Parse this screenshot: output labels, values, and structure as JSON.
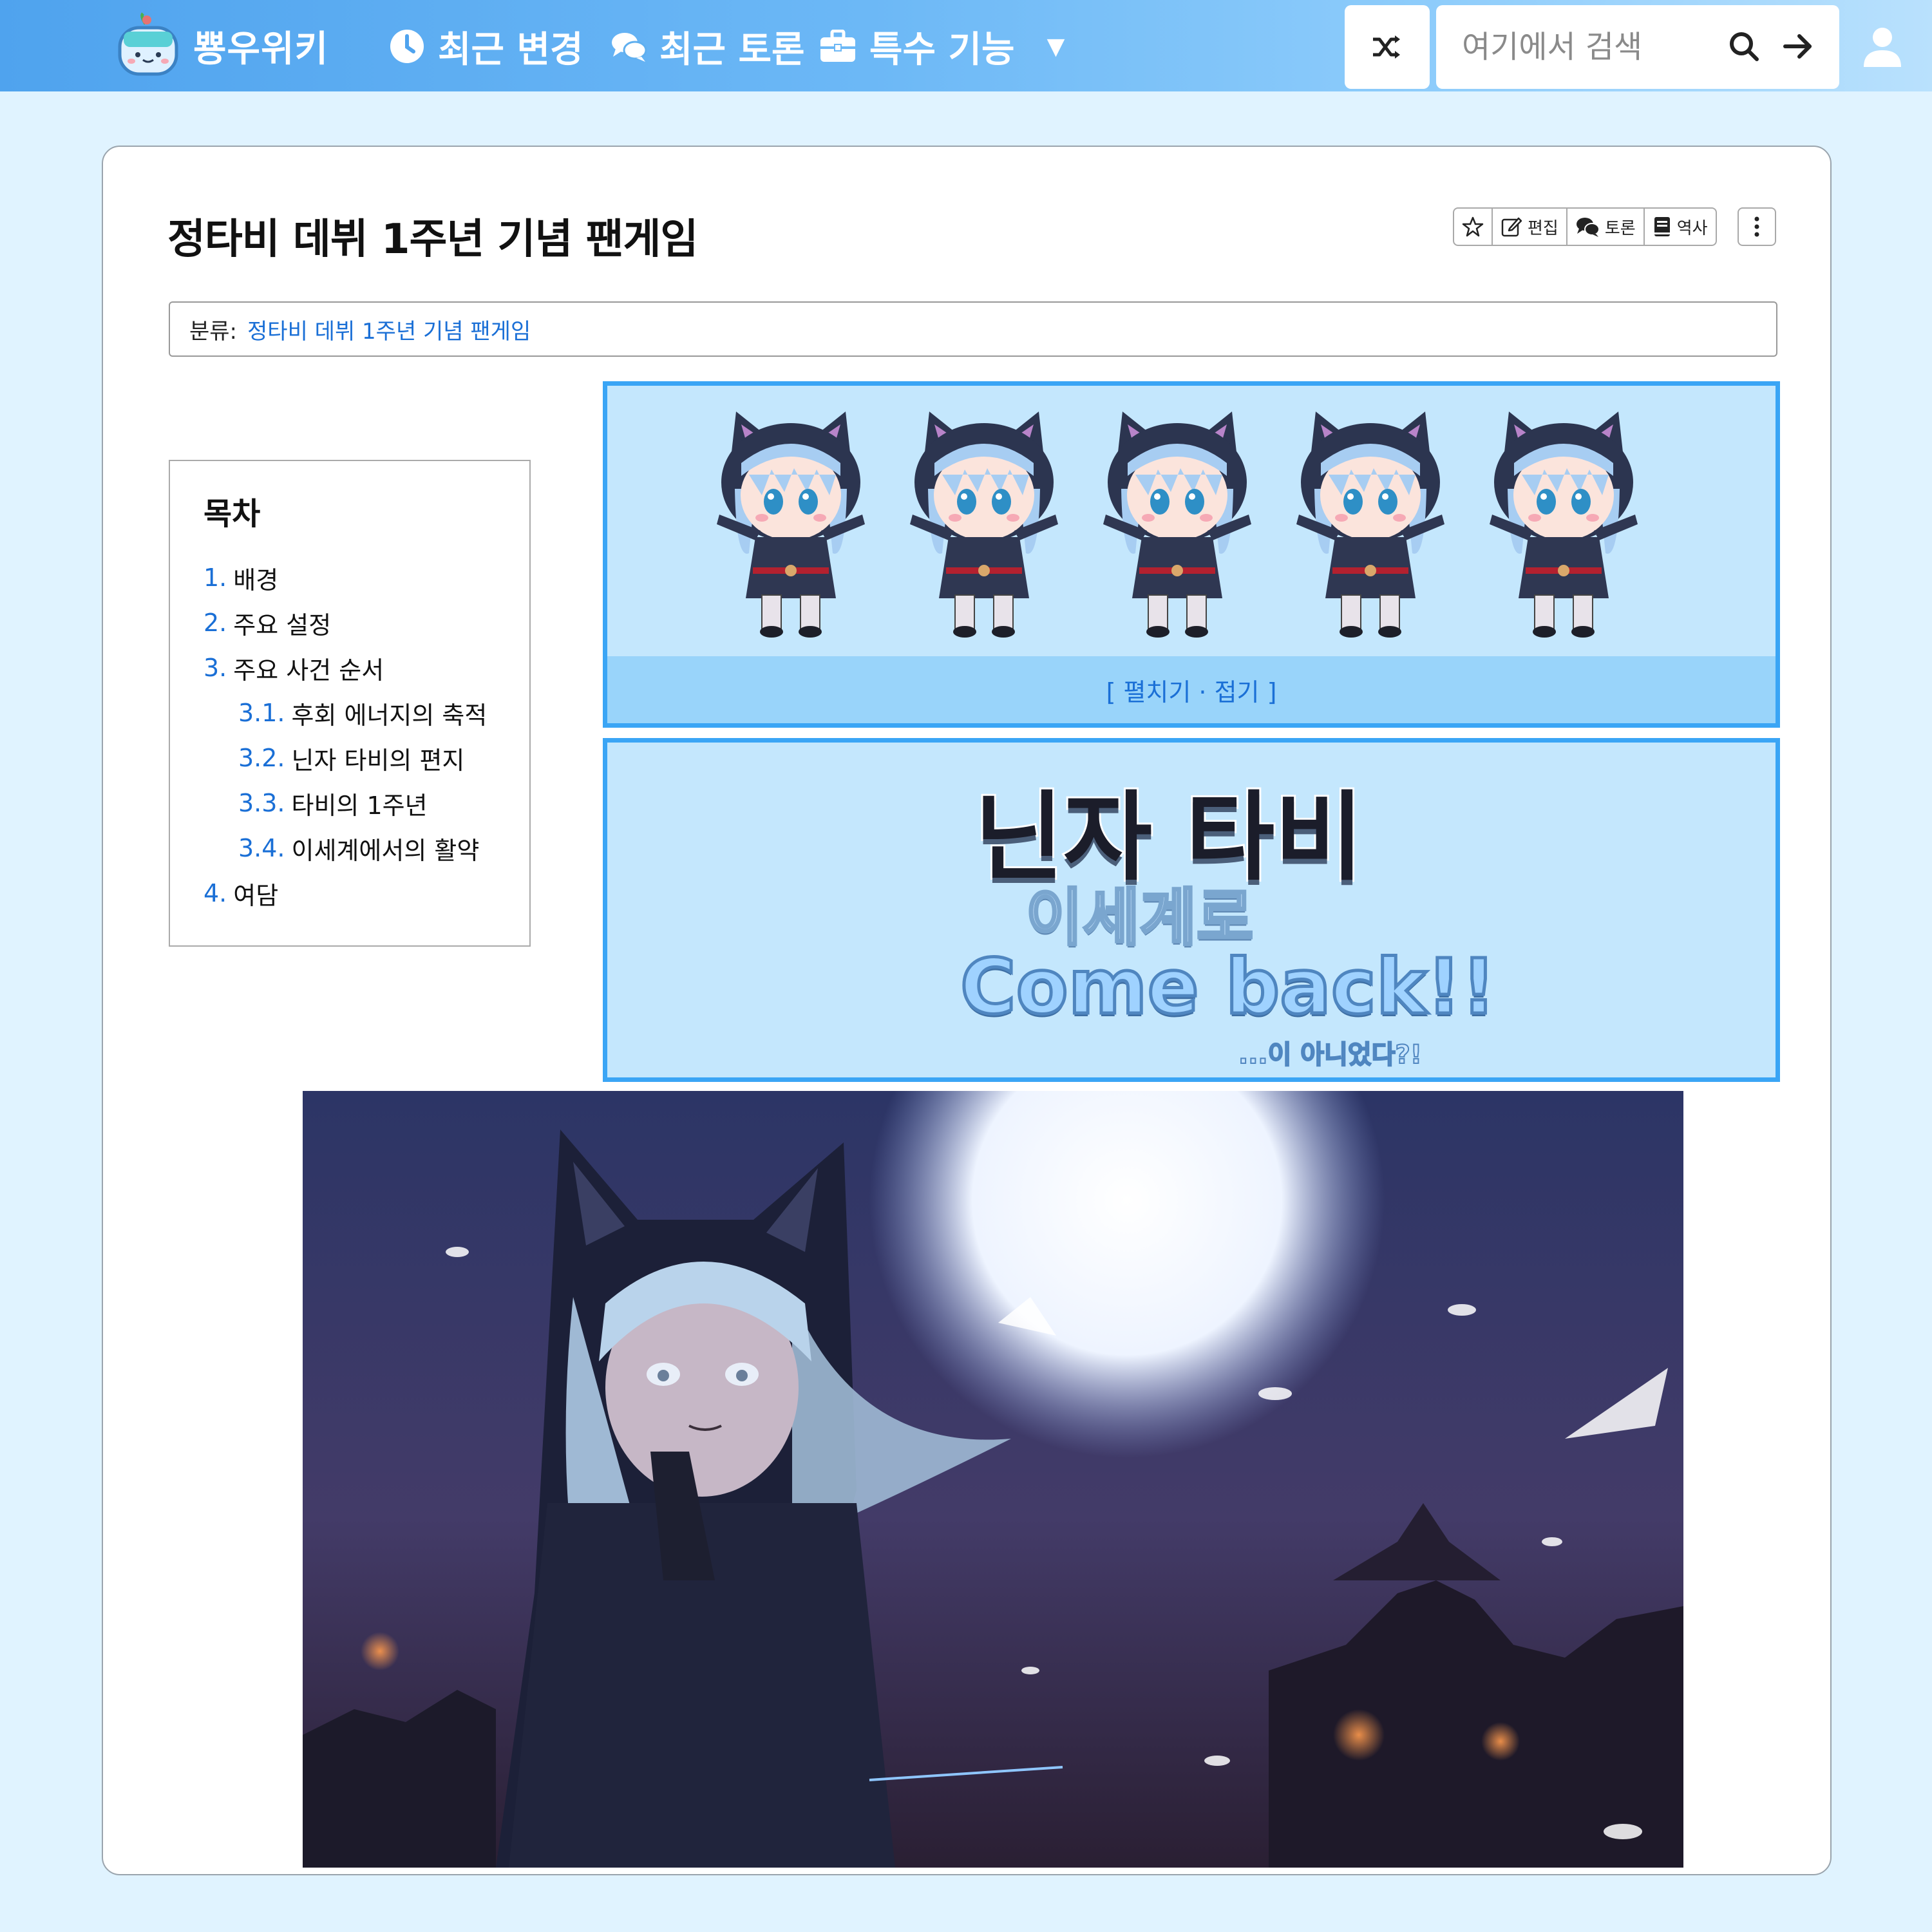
{
  "navbar": {
    "brand": "뿅우위키",
    "recent_changes": "최근 변경",
    "recent_discussions": "최근 토론",
    "special": "특수 기능",
    "search_placeholder": "여기에서 검색"
  },
  "page": {
    "title": "정타비 데뷔 1주년 기념 팬게임",
    "actions": [
      "편집",
      "토론",
      "역사"
    ],
    "category_label": "분류:",
    "category_link": "정타비 데뷔 1주년 기념 팬게임"
  },
  "toc": {
    "title": "목차",
    "items": [
      {
        "num": "1.",
        "label": "배경"
      },
      {
        "num": "2.",
        "label": "주요 설정"
      },
      {
        "num": "3.",
        "label": "주요 사건 순서"
      },
      {
        "num": "3.1.",
        "label": "후회 에너지의 축적"
      },
      {
        "num": "3.2.",
        "label": "닌자 타비의 편지"
      },
      {
        "num": "3.3.",
        "label": "타비의 1주년"
      },
      {
        "num": "3.4.",
        "label": "이세계에서의 활약"
      },
      {
        "num": "4.",
        "label": "여담"
      }
    ]
  },
  "banner": {
    "fold_toggle": "[ 펼치기 · 접기 ]",
    "logo_line1": "닌자 타비",
    "logo_line2": "이세계로",
    "logo_line3": "Come back!!",
    "logo_line4": "...이 아니었다?!"
  },
  "colors": {
    "nav_gradient_start": "#4fa3ee",
    "accent_border": "#3aa5f5",
    "banner_bg": "#c4e7fd",
    "link": "#1a6fd6",
    "page_bg": "#e0f3ff"
  },
  "icons": [
    "wiki-logo-icon",
    "clock-icon",
    "chat-icon",
    "briefcase-icon",
    "shuffle-icon",
    "search-icon",
    "arrow-right-icon",
    "user-icon",
    "star-icon",
    "edit-icon",
    "discussion-icon",
    "history-icon",
    "more-vertical-icon"
  ]
}
